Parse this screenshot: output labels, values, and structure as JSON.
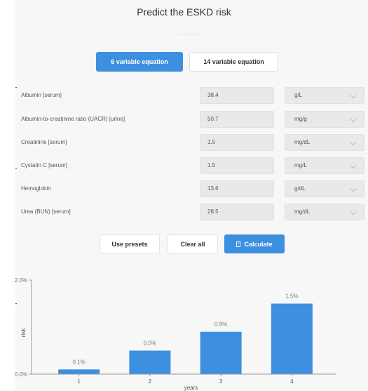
{
  "header": {
    "title": "Predict the ESKD risk"
  },
  "tabs": [
    {
      "label": "6 variable equation",
      "active": true
    },
    {
      "label": "14 variable equation",
      "active": false
    }
  ],
  "variables": [
    {
      "label": "Albumin [serum]",
      "value": "38.4",
      "unit": "g/L"
    },
    {
      "label": "Albumin-to-creatinine ratio (UACR) [urine]",
      "value": "50.7",
      "unit": "mg/g"
    },
    {
      "label": "Creatinine [serum]",
      "value": "1.5",
      "unit": "mg/dL"
    },
    {
      "label": "Cystatin C [serum]",
      "value": "1.5",
      "unit": "mg/L"
    },
    {
      "label": "Hemoglobin",
      "value": "13.6",
      "unit": "g/dL"
    },
    {
      "label": "Urea (BUN) [serum]",
      "value": "28.5",
      "unit": "mg/dL"
    }
  ],
  "actions": {
    "presets_label": "Use presets",
    "clear_label": "Clear all",
    "calculate_label": "Calculate",
    "calculate_icon": "calculator-icon"
  },
  "colors": {
    "accent": "#3d8fe0",
    "bar": "#3d8fe0"
  },
  "chart_data": {
    "type": "bar",
    "categories": [
      "1",
      "2",
      "3",
      "4"
    ],
    "values": [
      0.1,
      0.5,
      0.9,
      1.5
    ],
    "data_labels": [
      "0.1%",
      "0.5%",
      "0.9%",
      "1.5%"
    ],
    "xlabel": "years",
    "ylabel": "risk",
    "ylim": [
      0,
      2.0
    ],
    "yticks": [
      "0.0%",
      "2.0%"
    ],
    "grid": false
  }
}
